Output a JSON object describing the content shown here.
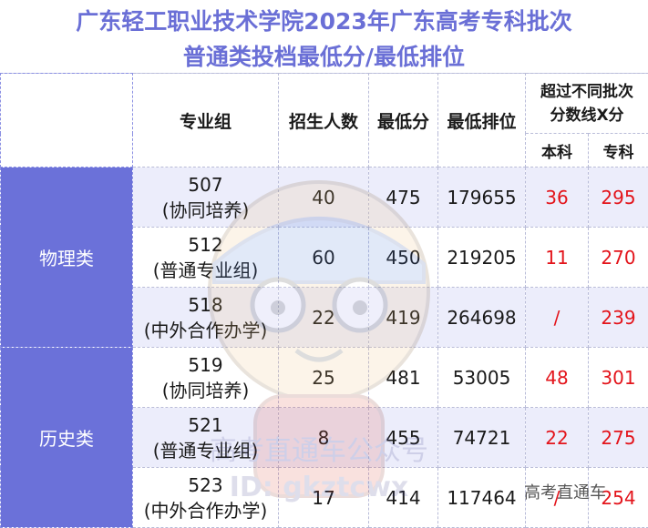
{
  "title": {
    "line1": "广东轻工职业技术学院2023年广东高考专科批次",
    "line2": "普通类投档最低分/最低排位"
  },
  "header": {
    "source": "@高考直通车",
    "group": "专业组",
    "enroll": "招生人数",
    "min_score": "最低分",
    "min_rank": "最低排位",
    "exceed": "超过不同批次分数线X分",
    "undergrad": "本科",
    "junior": "专科"
  },
  "sections": [
    {
      "name": "物理类",
      "rows": [
        {
          "code": "507",
          "type": "(协同培养)",
          "enroll": "40",
          "min_score": "475",
          "min_rank": "179655",
          "undergrad": "36",
          "junior": "295"
        },
        {
          "code": "512",
          "type": "(普通专业组)",
          "enroll": "60",
          "min_score": "450",
          "min_rank": "219205",
          "undergrad": "11",
          "junior": "270"
        },
        {
          "code": "518",
          "type": "(中外合作办学)",
          "enroll": "22",
          "min_score": "419",
          "min_rank": "264698",
          "undergrad": "/",
          "junior": "239"
        }
      ]
    },
    {
      "name": "历史类",
      "rows": [
        {
          "code": "519",
          "type": "(协同培养)",
          "enroll": "25",
          "min_score": "481",
          "min_rank": "53005",
          "undergrad": "48",
          "junior": "301"
        },
        {
          "code": "521",
          "type": "(普通专业组)",
          "enroll": "8",
          "min_score": "455",
          "min_rank": "74721",
          "undergrad": "22",
          "junior": "275"
        },
        {
          "code": "523",
          "type": "(中外合作办学)",
          "enroll": "17",
          "min_score": "414",
          "min_rank": "117464",
          "undergrad": "/",
          "junior": "254"
        }
      ]
    }
  ],
  "watermark": {
    "text1": "高考直通车公众号",
    "text2": "ID: gkztcwx",
    "corner": "高考直通车"
  },
  "colors": {
    "accent": "#6b71d9",
    "title": "#6a6fd6",
    "highlight": "#e3141b",
    "band": "#ecedfb"
  }
}
